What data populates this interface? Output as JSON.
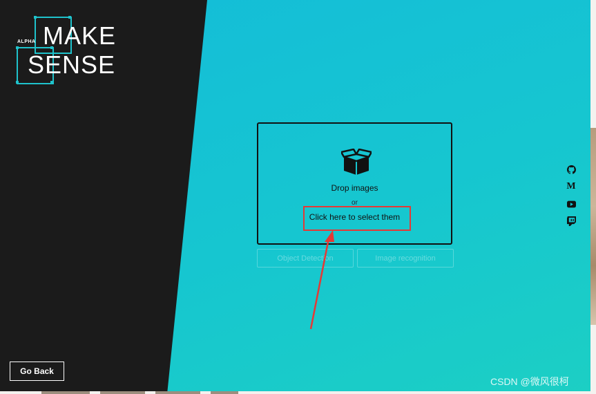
{
  "logo": {
    "badge": "ALPHA",
    "line1": "MAKE",
    "line2": "SENSE"
  },
  "dropzone": {
    "icon": "open-box-icon",
    "primary_label": "Drop images",
    "or_label": "or",
    "select_label": "Click here to select them"
  },
  "modes": {
    "object_detection": "Object Detection",
    "image_recognition": "Image recognition"
  },
  "social": [
    "github-icon",
    "medium-icon",
    "youtube-icon",
    "twitch-icon"
  ],
  "social_medium_glyph": "M",
  "go_back_label": "Go Back",
  "watermark": "CSDN @微风很柯",
  "colors": {
    "left_panel": "#1b1b1b",
    "accent": "#1fc3cc",
    "background_gradient_start": "#14bcd9",
    "background_gradient_end": "#1ccfc4",
    "annotation_red": "#e53935"
  }
}
